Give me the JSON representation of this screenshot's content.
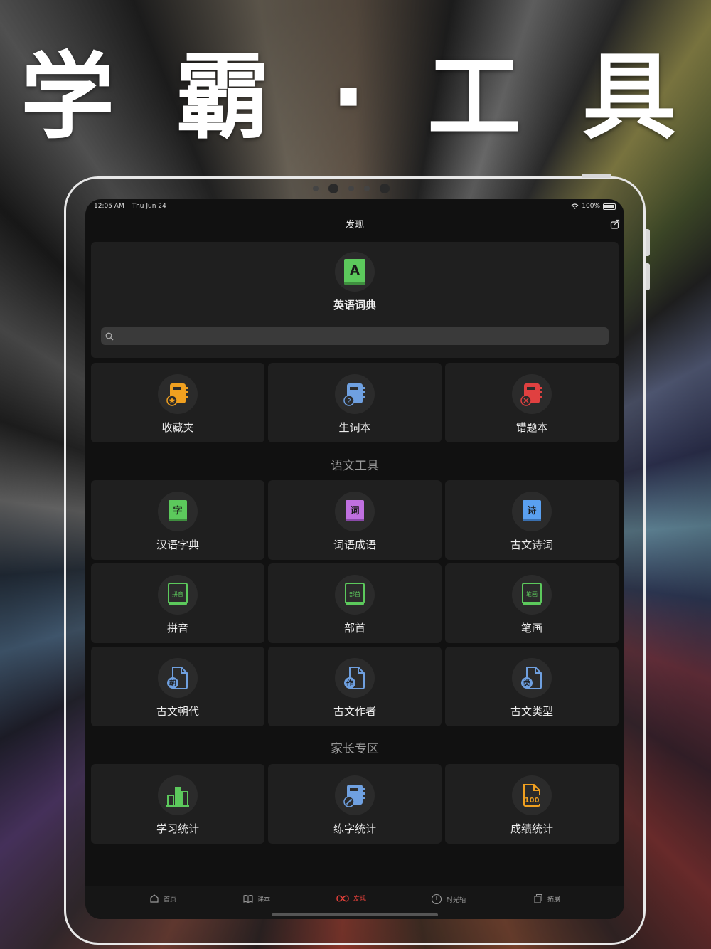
{
  "headline": "学 霸 · 工 具",
  "status": {
    "time": "12:05 AM",
    "date": "Thu Jun 24",
    "battery": "100%"
  },
  "nav": {
    "title": "发现"
  },
  "dictionary": {
    "label": "英语词典",
    "icon_letter": "A",
    "search_placeholder": ""
  },
  "row1": [
    {
      "label": "收藏夹",
      "icon": "star-notebook-icon",
      "color": "#f0a020"
    },
    {
      "label": "生词本",
      "icon": "question-notebook-icon",
      "color": "#6fa0e0"
    },
    {
      "label": "错题本",
      "icon": "cross-notebook-icon",
      "color": "#e04040"
    }
  ],
  "section_chinese": "语文工具",
  "chinese_tools": [
    {
      "label": "汉语字典",
      "glyph": "字",
      "color": "#5cc95c"
    },
    {
      "label": "词语成语",
      "glyph": "词",
      "color": "#c070e0"
    },
    {
      "label": "古文诗词",
      "glyph": "诗",
      "color": "#5aa0f0"
    },
    {
      "label": "拼音",
      "glyph": "拼音",
      "color": "#5cc95c"
    },
    {
      "label": "部首",
      "glyph": "部首",
      "color": "#5cc95c"
    },
    {
      "label": "笔画",
      "glyph": "笔画",
      "color": "#5cc95c"
    },
    {
      "label": "古文朝代",
      "glyph": "朝",
      "color": "#6fa0e0"
    },
    {
      "label": "古文作者",
      "glyph": "作",
      "color": "#6fa0e0"
    },
    {
      "label": "古文类型",
      "glyph": "类",
      "color": "#6fa0e0"
    }
  ],
  "section_parents": "家长专区",
  "parent_tools": [
    {
      "label": "学习统计",
      "icon": "bar-chart-icon",
      "color": "#5cc95c"
    },
    {
      "label": "练字统计",
      "icon": "pencil-notebook-icon",
      "color": "#6fa0e0"
    },
    {
      "label": "成绩统计",
      "icon": "score-100-icon",
      "color": "#f0a020",
      "glyph": "100"
    }
  ],
  "tabs": [
    {
      "label": "首页",
      "icon": "home-icon"
    },
    {
      "label": "课本",
      "icon": "book-icon"
    },
    {
      "label": "发现",
      "icon": "infinity-icon",
      "active": true
    },
    {
      "label": "时光轴",
      "icon": "timeline-icon"
    },
    {
      "label": "拓展",
      "icon": "copy-icon"
    }
  ],
  "colors": {
    "accent": "#e4403a",
    "card": "#1f1f1f",
    "background": "#111111"
  }
}
